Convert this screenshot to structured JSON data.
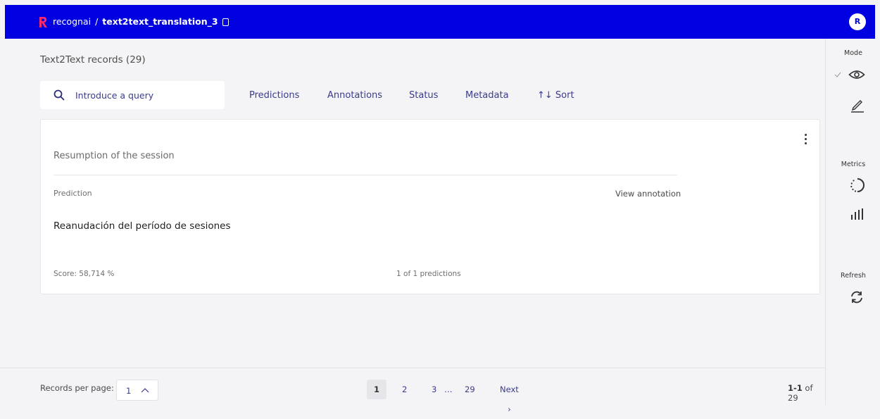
{
  "header": {
    "workspace": "recognai",
    "separator": "/",
    "dataset": "text2text_translation_3",
    "avatar_initial": "R",
    "bg_color": "#0000e0"
  },
  "page": {
    "title": "Text2Text records (29)"
  },
  "search": {
    "placeholder": "Introduce a query"
  },
  "filters": {
    "predictions": "Predictions",
    "annotations": "Annotations",
    "status": "Status",
    "metadata": "Metadata",
    "sort": "↑↓ Sort"
  },
  "record": {
    "source_text": "Resumption of the session",
    "prediction_label": "Prediction",
    "view_annotation": "View annotation",
    "prediction_text": "Reanudación del período de sesiones",
    "score": "Score: 58,714 %",
    "predictions_count": "1 of 1 predictions"
  },
  "sidebar": {
    "mode_label": "Mode",
    "metrics_label": "Metrics",
    "refresh_label": "Refresh"
  },
  "footer": {
    "records_per_page_label": "Records per page:",
    "records_per_page_value": "1",
    "pages": [
      "1",
      "2",
      "3",
      "…",
      "29"
    ],
    "next_label": "Next ›",
    "range_bold": "1-1",
    "range_rest": " of 29"
  }
}
